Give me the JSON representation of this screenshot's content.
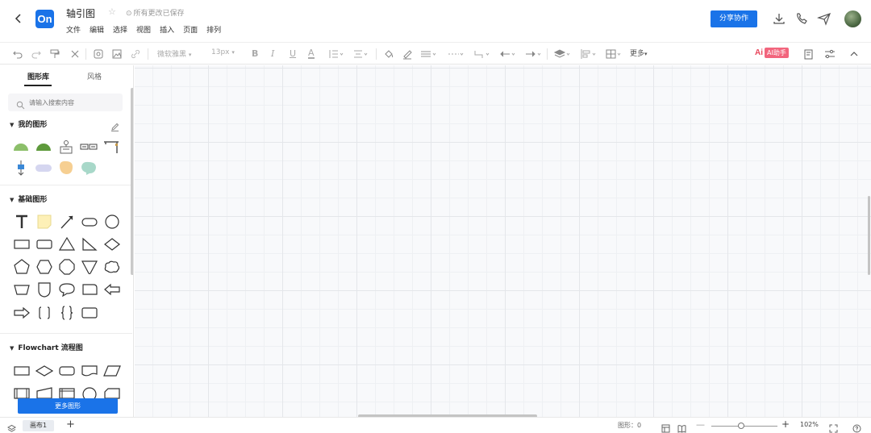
{
  "header": {
    "logo_text": "On",
    "title": "轴引图",
    "save_status": "所有更改已保存",
    "menu": [
      "文件",
      "编辑",
      "选择",
      "视图",
      "插入",
      "页面",
      "排列"
    ],
    "share_label": "分享协作"
  },
  "toolbar": {
    "font_name": "微软雅黑",
    "font_size": "13px",
    "ai_mark": "Ai",
    "ai_label": "AI助手",
    "more_label": "更多"
  },
  "sidebar": {
    "tabs": [
      "图形库",
      "风格"
    ],
    "search_placeholder": "请输入搜索内容",
    "sections": [
      {
        "label": "我的图形"
      },
      {
        "label": "基础图形"
      },
      {
        "label": "Flowchart 流程图"
      }
    ],
    "more_shapes_label": "更多图形"
  },
  "footer": {
    "page_tab": "画布1",
    "shapes_count_label": "图形：0",
    "zoom": "102%"
  },
  "colors": {
    "accent": "#1a73e8",
    "ai": "#f2657d",
    "my_shape_green_light": "#8cbf6a",
    "my_shape_green_dark": "#5e9a3c",
    "my_shape_lavender": "#d5d6f0",
    "my_shape_peach": "#f6cf92",
    "my_shape_mint": "#a8d8c9"
  }
}
